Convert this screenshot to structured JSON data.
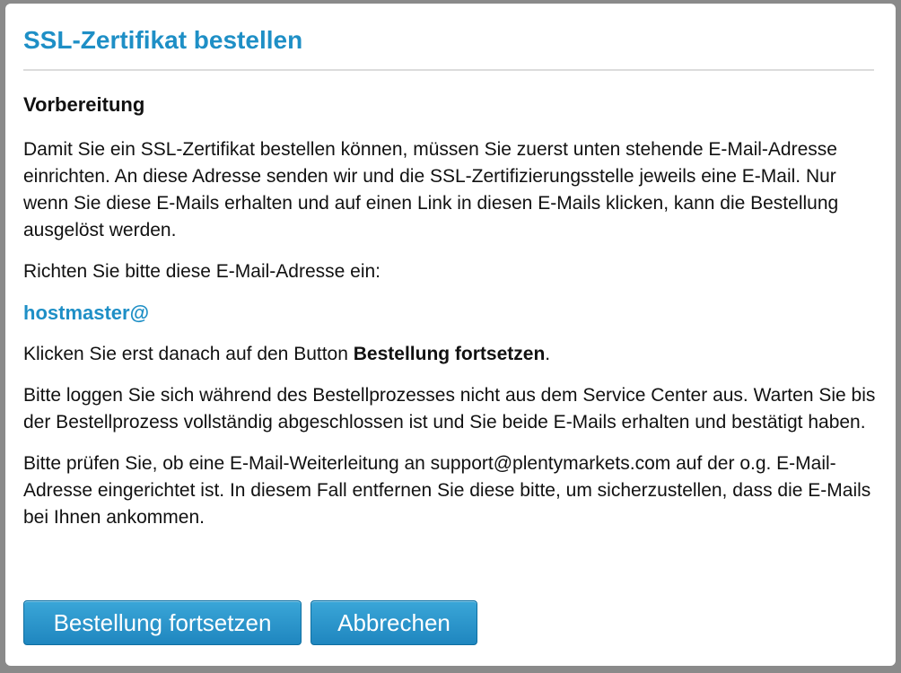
{
  "dialog": {
    "title": "SSL-Zertifikat bestellen",
    "section_heading": "Vorbereitung",
    "paragraph_intro": "Damit Sie ein SSL-Zertifikat bestellen können, müssen Sie zuerst unten stehende E-Mail-Adresse einrichten. An diese Adresse senden wir und die SSL-Zertifizierungsstelle jeweils eine E-Mail. Nur wenn Sie diese E-Mails erhalten und auf einen Link in diesen E-Mails klicken, kann die Bestellung ausgelöst werden.",
    "paragraph_setup": "Richten Sie bitte diese E-Mail-Adresse ein:",
    "email_address": "hostmaster@",
    "paragraph_click_prefix": "Klicken Sie erst danach auf den Button ",
    "paragraph_click_bold": "Bestellung fortsetzen",
    "paragraph_click_suffix": ".",
    "paragraph_stay_logged_in": "Bitte loggen Sie sich während des Bestellprozesses nicht aus dem Service Center aus. Warten Sie bis der Bestellprozess vollständig abgeschlossen ist und Sie beide E-Mails erhalten und bestätigt haben.",
    "paragraph_forwarding": "Bitte prüfen Sie, ob eine E-Mail-Weiterleitung an support@plentymarkets.com auf der o.g. E-Mail-Adresse eingerichtet ist. In diesem Fall entfernen Sie diese bitte, um sicherzustellen, dass die E-Mails bei Ihnen ankommen."
  },
  "buttons": {
    "continue_label": "Bestellung fortsetzen",
    "cancel_label": "Abbrechen"
  },
  "colors": {
    "accent": "#1e8fc6",
    "button_top": "#3aa6d8",
    "button_bottom": "#1f86bf",
    "text": "#111111"
  }
}
